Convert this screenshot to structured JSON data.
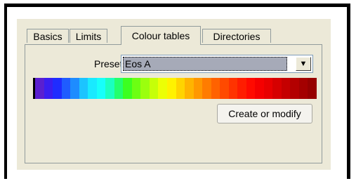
{
  "tabs": [
    {
      "label": "Basics",
      "active": false
    },
    {
      "label": "Limits",
      "active": false
    },
    {
      "label": "Colour tables",
      "active": true
    },
    {
      "label": "Directories",
      "active": false
    }
  ],
  "preset": {
    "label": "Preset",
    "value": "Eos A"
  },
  "colour_bar": {
    "colors": [
      "#5a1fd0",
      "#3a1ef0",
      "#1f2cff",
      "#1f5cff",
      "#1e8cff",
      "#1cc4ff",
      "#19eaff",
      "#17fffa",
      "#1bffc0",
      "#23ff6c",
      "#3cff20",
      "#6cff12",
      "#9bff0e",
      "#c6ff08",
      "#ecff05",
      "#fff200",
      "#ffd400",
      "#ffb400",
      "#ff9800",
      "#ff7c00",
      "#ff6200",
      "#ff4a00",
      "#ff3300",
      "#ff1d00",
      "#ff0a00",
      "#f50000",
      "#e80000",
      "#d60000",
      "#c50000",
      "#b30000",
      "#a40000",
      "#960000"
    ]
  },
  "actions": {
    "create_label": "Create or modify"
  },
  "icons": {
    "dropdown": "chevron-down-icon"
  }
}
